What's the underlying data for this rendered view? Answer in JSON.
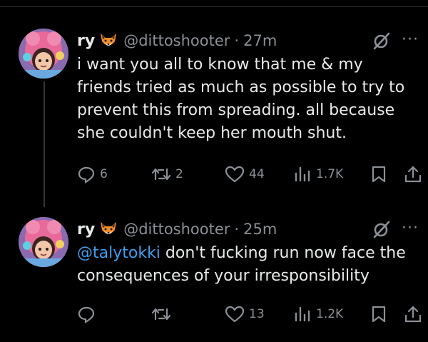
{
  "tweets": [
    {
      "name": "ry",
      "handle": "@dittoshooter",
      "separator": "·",
      "time": "27m",
      "text": "i want you all to know that me & my friends tried as much as possible to try to prevent this from spreading. all because she couldn't keep her mouth shut.",
      "replies": "6",
      "reposts": "2",
      "likes": "44",
      "views": "1.7K"
    },
    {
      "name": "ry",
      "handle": "@dittoshooter",
      "separator": "·",
      "time": "25m",
      "mention": "@talytokki",
      "text": " don't fucking run now face the consequences of your irresponsibility",
      "replies": "",
      "reposts": "",
      "likes": "13",
      "views": "1.2K"
    }
  ],
  "more_label": "···",
  "colors": {
    "accent": "#3c9ef0",
    "muted": "#8b9096",
    "text": "#e7e9ea",
    "background": "#000000"
  },
  "icons": [
    "fox-emoji-icon",
    "grok-icon",
    "more-icon",
    "reply-icon",
    "repost-icon",
    "like-icon",
    "views-icon",
    "bookmark-icon",
    "share-icon"
  ]
}
